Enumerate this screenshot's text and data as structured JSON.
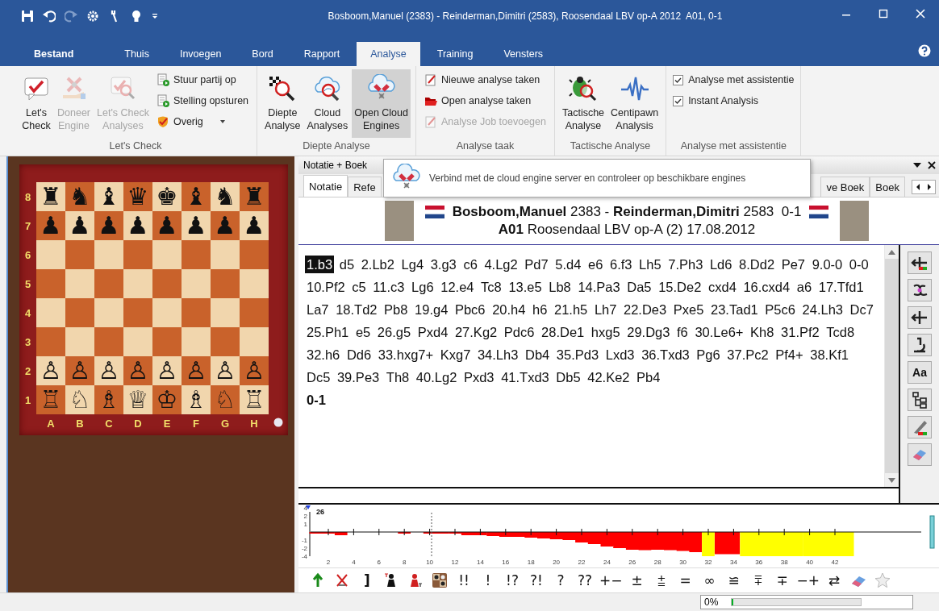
{
  "window": {
    "title": "Bosboom,Manuel (2383) - Reinderman,Dimitri (2583), Roosendaal LBV op-A 2012  A01, 0-1"
  },
  "ribbon_tabs": [
    {
      "label": "Bestand",
      "kind": "file",
      "selected": false
    },
    {
      "label": "Thuis",
      "kind": "tab",
      "selected": false
    },
    {
      "label": "Invoegen",
      "kind": "tab",
      "selected": false
    },
    {
      "label": "Bord",
      "kind": "tab",
      "selected": false
    },
    {
      "label": "Rapport",
      "kind": "tab",
      "selected": false
    },
    {
      "label": "Analyse",
      "kind": "tab",
      "selected": true
    },
    {
      "label": "Training",
      "kind": "tab",
      "selected": false
    },
    {
      "label": "Vensters",
      "kind": "tab",
      "selected": false
    }
  ],
  "ribbon_groups": [
    {
      "label": "Let's Check",
      "items": [
        {
          "kind": "large",
          "label": "Let's\nCheck",
          "disabled": false,
          "highlighted": false
        },
        {
          "kind": "large",
          "label": "Doneer\nEngine",
          "disabled": true,
          "highlighted": false
        },
        {
          "kind": "large",
          "label": "Let's Check\nAnalyses",
          "disabled": true,
          "highlighted": false
        },
        {
          "kind": "stack",
          "items": [
            {
              "kind": "small",
              "label": "Stuur partij op",
              "disabled": false,
              "dropdown": false
            },
            {
              "kind": "small",
              "label": "Stelling opsturen",
              "disabled": false,
              "dropdown": false
            },
            {
              "kind": "small",
              "label": "Overig",
              "disabled": false,
              "dropdown": true
            }
          ]
        }
      ]
    },
    {
      "label": "Diepte Analyse",
      "items": [
        {
          "kind": "large",
          "label": "Diepte\nAnalyse",
          "disabled": false,
          "highlighted": false
        },
        {
          "kind": "large",
          "label": "Cloud\nAnalyses",
          "disabled": false,
          "highlighted": false
        },
        {
          "kind": "large",
          "label": "Open Cloud\nEngines",
          "disabled": false,
          "highlighted": true
        }
      ]
    },
    {
      "label": "Analyse taak",
      "items": [
        {
          "kind": "stack",
          "items": [
            {
              "kind": "small",
              "label": "Nieuwe analyse taken",
              "disabled": false,
              "dropdown": false
            },
            {
              "kind": "small",
              "label": "Open analyse taken",
              "disabled": false,
              "dropdown": false
            },
            {
              "kind": "small",
              "label": "Analyse Job toevoegen",
              "disabled": true,
              "dropdown": false
            }
          ]
        }
      ]
    },
    {
      "label": "Tactische Analyse",
      "items": [
        {
          "kind": "large",
          "label": "Tactische\nAnalyse",
          "disabled": false,
          "highlighted": false
        },
        {
          "kind": "large",
          "label": "Centipawn\nAnalysis",
          "disabled": false,
          "highlighted": false
        }
      ]
    },
    {
      "label": "Analyse met assistentie",
      "items": [
        {
          "kind": "stack",
          "items": [
            {
              "kind": "check",
              "label": "Analyse met assistentie",
              "checked": true
            },
            {
              "kind": "check",
              "label": "Instant Analysis",
              "checked": true
            }
          ]
        }
      ]
    }
  ],
  "board": {
    "white_to_move": true,
    "files": [
      "A",
      "B",
      "C",
      "D",
      "E",
      "F",
      "G",
      "H"
    ],
    "ranks": [
      {
        "label": "8",
        "pieces": [
          "♜",
          "♞",
          "♝",
          "♛",
          "♚",
          "♝",
          "♞",
          "♜"
        ]
      },
      {
        "label": "7",
        "pieces": [
          "♟",
          "♟",
          "♟",
          "♟",
          "♟",
          "♟",
          "♟",
          "♟"
        ]
      },
      {
        "label": "6"
      },
      {
        "label": "5"
      },
      {
        "label": "4"
      },
      {
        "label": "3"
      },
      {
        "label": "2",
        "pieces": [
          "♙",
          "♙",
          "♙",
          "♙",
          "♙",
          "♙",
          "♙",
          "♙"
        ]
      },
      {
        "label": "1",
        "pieces": [
          "♖",
          "♘",
          "♗",
          "♕",
          "♔",
          "♗",
          "♘",
          "♖"
        ]
      }
    ]
  },
  "panel": {
    "title": "Notatie + Boek",
    "tabs": [
      {
        "label": "Notatie",
        "selected": true
      },
      {
        "label": "Refe",
        "selected": false
      },
      {
        "label": "ve Boek",
        "selected": false
      },
      {
        "label": "Boek",
        "selected": false
      }
    ]
  },
  "tooltip": {
    "text": "Verbind met de cloud engine server en controleer op beschikbare engines"
  },
  "game_header": {
    "players": "**Bosboom,Manuel** 2383 - **Reinderman,Dimitri** 2583  0-1",
    "event": "**A01** Roosendaal LBV op-A (2) 17.08.2012"
  },
  "notation": {
    "result": "0-1",
    "moves": [
      {
        "text": "1.b3",
        "selected": true
      },
      {
        "text": "d5",
        "selected": false
      },
      {
        "text": "2.Lb2",
        "selected": false
      },
      {
        "text": "Lg4",
        "selected": false
      },
      {
        "text": "3.g3",
        "selected": false
      },
      {
        "text": "c6",
        "selected": false
      },
      {
        "text": "4.Lg2",
        "selected": false
      },
      {
        "text": "Pd7",
        "selected": false
      },
      {
        "text": "5.d4",
        "selected": false
      },
      {
        "text": "e6",
        "selected": false
      },
      {
        "text": "6.f3",
        "selected": false
      },
      {
        "text": "Lh5",
        "selected": false
      },
      {
        "text": "7.Ph3",
        "selected": false
      },
      {
        "text": "Ld6",
        "selected": false
      },
      {
        "text": "8.Dd2",
        "selected": false
      },
      {
        "text": "Pe7",
        "selected": false
      },
      {
        "text": "9.0-0",
        "selected": false
      },
      {
        "text": "0-0",
        "selected": false
      },
      {
        "text": "10.Pf2",
        "selected": false
      },
      {
        "text": "c5",
        "selected": false
      },
      {
        "text": "11.c3",
        "selected": false
      },
      {
        "text": "Lg6",
        "selected": false
      },
      {
        "text": "12.e4",
        "selected": false
      },
      {
        "text": "Tc8",
        "selected": false
      },
      {
        "text": "13.e5",
        "selected": false
      },
      {
        "text": "Lb8",
        "selected": false
      },
      {
        "text": "14.Pa3",
        "selected": false
      },
      {
        "text": "Da5",
        "selected": false
      },
      {
        "text": "15.De2",
        "selected": false
      },
      {
        "text": "cxd4",
        "selected": false
      },
      {
        "text": "16.cxd4",
        "selected": false
      },
      {
        "text": "a6",
        "selected": false
      },
      {
        "text": "17.Tfd1",
        "selected": false
      },
      {
        "text": "La7",
        "selected": false
      },
      {
        "text": "18.Td2",
        "selected": false
      },
      {
        "text": "Pb8",
        "selected": false
      },
      {
        "text": "19.g4",
        "selected": false
      },
      {
        "text": "Pbc6",
        "selected": false
      },
      {
        "text": "20.h4",
        "selected": false
      },
      {
        "text": "h6",
        "selected": false
      },
      {
        "text": "21.h5",
        "selected": false
      },
      {
        "text": "Lh7",
        "selected": false
      },
      {
        "text": "22.De3",
        "selected": false
      },
      {
        "text": "Pxe5",
        "selected": false
      },
      {
        "text": "23.Tad1",
        "selected": false
      },
      {
        "text": "P5c6",
        "selected": false
      },
      {
        "text": "24.Lh3",
        "selected": false
      },
      {
        "text": "Dc7",
        "selected": false
      },
      {
        "text": "25.Ph1",
        "selected": false
      },
      {
        "text": "e5",
        "selected": false
      },
      {
        "text": "26.g5",
        "selected": false
      },
      {
        "text": "Pxd4",
        "selected": false
      },
      {
        "text": "27.Kg2",
        "selected": false
      },
      {
        "text": "Pdc6",
        "selected": false
      },
      {
        "text": "28.De1",
        "selected": false
      },
      {
        "text": "hxg5",
        "selected": false
      },
      {
        "text": "29.Dg3",
        "selected": false
      },
      {
        "text": "f6",
        "selected": false
      },
      {
        "text": "30.Le6+",
        "selected": false
      },
      {
        "text": "Kh8",
        "selected": false
      },
      {
        "text": "31.Pf2",
        "selected": false
      },
      {
        "text": "Tcd8",
        "selected": false
      },
      {
        "text": "32.h6",
        "selected": false
      },
      {
        "text": "Dd6",
        "selected": false
      },
      {
        "text": "33.hxg7+",
        "selected": false
      },
      {
        "text": "Kxg7",
        "selected": false
      },
      {
        "text": "34.Lh3",
        "selected": false
      },
      {
        "text": "Db4",
        "selected": false
      },
      {
        "text": "35.Pd3",
        "selected": false
      },
      {
        "text": "Lxd3",
        "selected": false
      },
      {
        "text": "36.Txd3",
        "selected": false
      },
      {
        "text": "Pg6",
        "selected": false
      },
      {
        "text": "37.Pc2",
        "selected": false
      },
      {
        "text": "Pf4+",
        "selected": false
      },
      {
        "text": "38.Kf1",
        "selected": false
      },
      {
        "text": "Dc5",
        "selected": false
      },
      {
        "text": "39.Pe3",
        "selected": false
      },
      {
        "text": "Th8",
        "selected": false
      },
      {
        "text": "40.Lg2",
        "selected": false
      },
      {
        "text": "Pxd3",
        "selected": false
      },
      {
        "text": "41.Txd3",
        "selected": false
      },
      {
        "text": "Db5",
        "selected": false
      },
      {
        "text": "42.Ke2",
        "selected": false
      },
      {
        "text": "Pb4",
        "selected": false
      }
    ]
  },
  "side_toolbar": {
    "text_button": "Aa"
  },
  "evaluation_graph": {
    "depth": "26",
    "y_labels": [
      "4",
      "2",
      "1",
      "-1",
      "-2",
      "-4"
    ],
    "x_labels": [
      "2",
      "4",
      "6",
      "8",
      "10",
      "12",
      "14",
      "16",
      "18",
      "20",
      "22",
      "24",
      "26",
      "28",
      "30",
      "32",
      "34",
      "36",
      "38",
      "40",
      "42"
    ]
  },
  "annotation_toolbar": {
    "bracket": "]",
    "symbols": [
      "!!",
      "!",
      "!?",
      "?!",
      "?",
      "??",
      "+−",
      "±",
      "⩲",
      "=",
      "∞",
      "≌",
      "⩱",
      "∓",
      "−+",
      "⇄"
    ]
  },
  "status_bar": {
    "progress": {
      "text": "0%",
      "level": 0
    }
  }
}
